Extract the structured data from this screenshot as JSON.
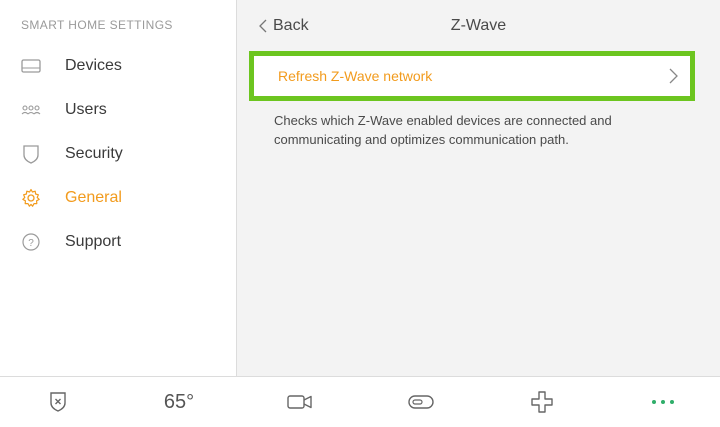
{
  "sidebar": {
    "heading": "SMART HOME SETTINGS",
    "items": [
      {
        "label": "Devices",
        "icon": "devices-icon",
        "active": false
      },
      {
        "label": "Users",
        "icon": "users-icon",
        "active": false
      },
      {
        "label": "Security",
        "icon": "shield-icon",
        "active": false
      },
      {
        "label": "General",
        "icon": "gear-icon",
        "active": true
      },
      {
        "label": "Support",
        "icon": "question-icon",
        "active": false
      }
    ]
  },
  "header": {
    "back_label": "Back",
    "title": "Z-Wave"
  },
  "main": {
    "refresh_label": "Refresh Z-Wave network",
    "description": "Checks which Z-Wave enabled devices are connected and communicating and optimizes communication path."
  },
  "bottom_bar": {
    "temperature": "65°",
    "tabs": [
      "security-shield-icon",
      "thermostat",
      "camera-icon",
      "toggle-icon",
      "plus-icon",
      "more-icon"
    ]
  },
  "colors": {
    "accent": "#f29b1d",
    "highlight": "#6cc51f",
    "more_dots": "#2fae6a"
  }
}
